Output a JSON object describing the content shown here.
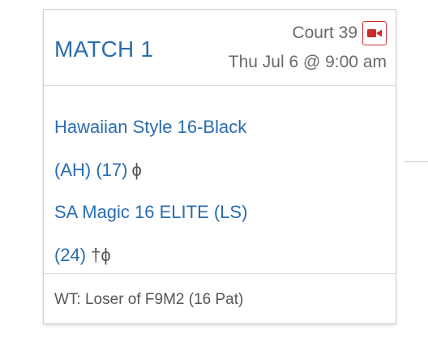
{
  "match": {
    "title": "MATCH 1",
    "court": "Court 39",
    "datetime": "Thu Jul 6 @ 9:00 am",
    "video_icon": "video-camera-icon",
    "team1": {
      "name": "Hawaiian Style 16-Black",
      "region": "(AH)",
      "seed": "(17)",
      "symbols": "ϕ"
    },
    "team2": {
      "name": "SA Magic 16 ELITE (LS)",
      "seed": "(24)",
      "symbols": "†ϕ"
    },
    "work_team": "WT: Loser of F9M2 (16 Pat)"
  },
  "colors": {
    "link": "#2a6cb0",
    "muted": "#6a6a6a",
    "video_red": "#cc2b2b",
    "border": "#cfcfcf"
  }
}
